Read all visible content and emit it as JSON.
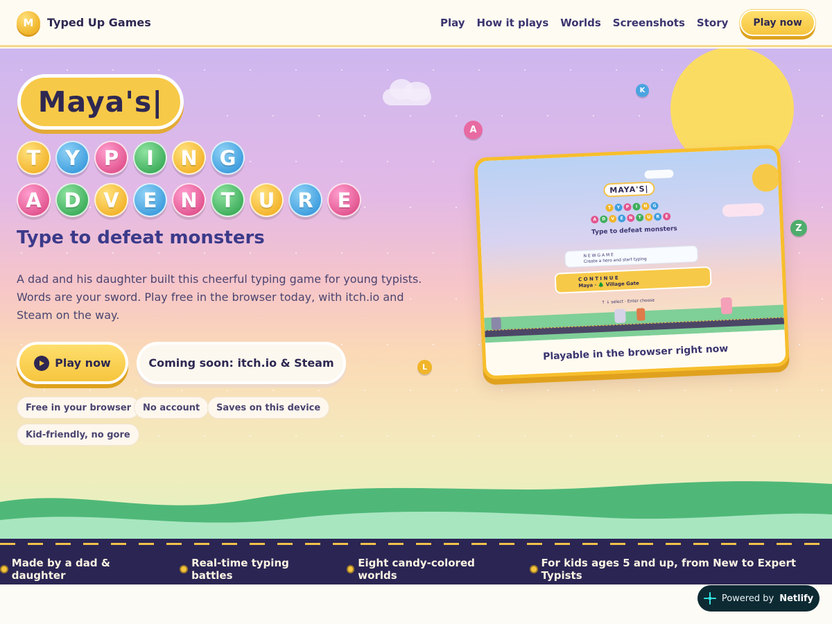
{
  "header": {
    "logo_letter": "M",
    "brand": "Typed Up Games",
    "nav": [
      "Play",
      "How it plays",
      "Worlds",
      "Screenshots",
      "Story"
    ],
    "cta": "Play now"
  },
  "hero": {
    "title_word": "Maya's|",
    "title_row1": [
      "T",
      "Y",
      "P",
      "I",
      "N",
      "G"
    ],
    "title_row2": [
      "A",
      "D",
      "V",
      "E",
      "N",
      "T",
      "U",
      "R",
      "E"
    ],
    "tagline": "Type to defeat monsters",
    "description": "A dad and his daughter built this cheerful typing game for young typists. Words are your sword. Play free in the browser today, with itch.io and Steam on the way.",
    "play_button": "Play now",
    "coming_soon_button": "Coming soon: itch.io & Steam",
    "chips": [
      "Free in your browser",
      "No account",
      "Saves on this device",
      "Kid-friendly, no gore"
    ],
    "floating_letters": [
      "A",
      "K",
      "Z",
      "L"
    ]
  },
  "preview": {
    "game_title": "MAYA'S|",
    "mini_row1": [
      "T",
      "Y",
      "P",
      "I",
      "N",
      "G"
    ],
    "mini_row2": [
      "A",
      "D",
      "V",
      "E",
      "N",
      "T",
      "U",
      "R",
      "E"
    ],
    "game_tagline": "Type to defeat monsters",
    "new_game_label": "N E W   G A M E",
    "new_game_sub": "Create a hero and start typing",
    "continue_label": "C O N T I N U E",
    "continue_sub": "Maya · 🌲 Village Gate",
    "hint": "↑ ↓ select · Enter choose",
    "caption": "Playable in the browser right now"
  },
  "strip": {
    "items": [
      "Made by a dad & daughter",
      "Real-time typing battles",
      "Eight candy-colored worlds",
      "For kids ages 5 and up, from New to Expert Typists"
    ]
  },
  "badge": {
    "prefix": "Powered by",
    "name": "Netlify"
  },
  "colors": {
    "navy": "#2e2852",
    "gold": "#f6c53e",
    "strip_bg": "#2b2554",
    "hill_green": "#4fb878"
  }
}
